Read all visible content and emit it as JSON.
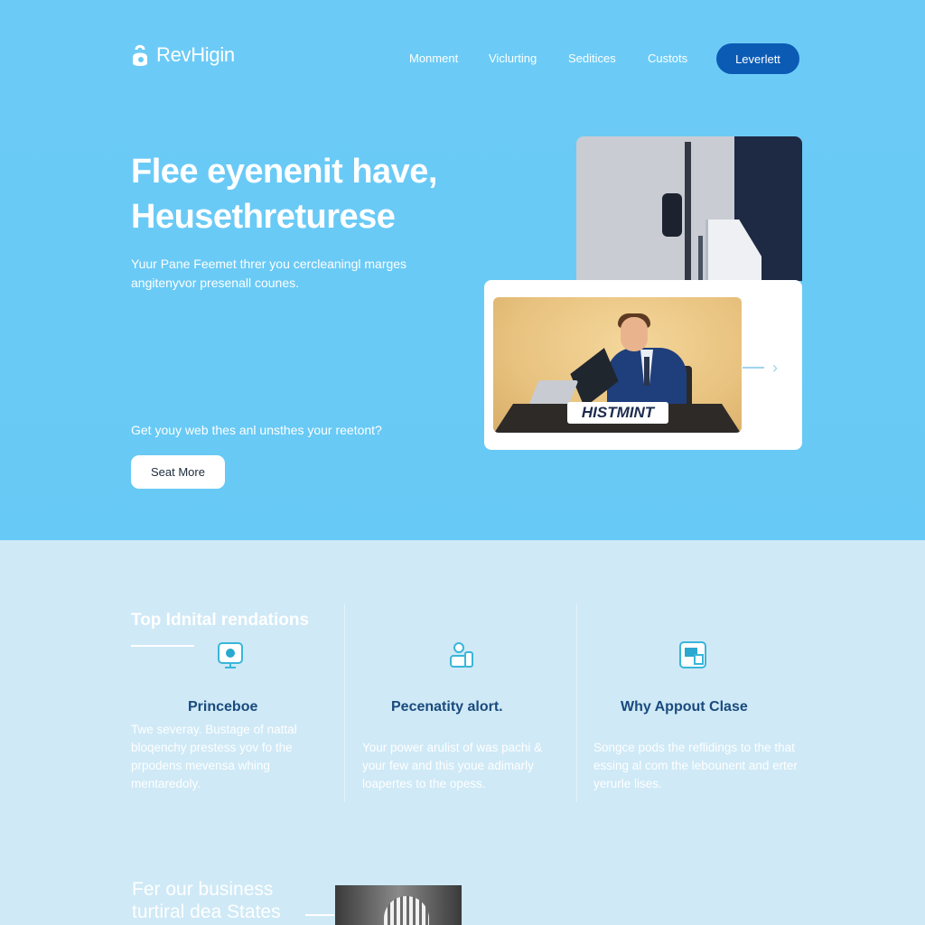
{
  "brand": {
    "name": "RevHigin"
  },
  "nav": {
    "links": [
      "Monment",
      "Viclurting",
      "Seditices",
      "Custots"
    ],
    "cta": "Leverlett"
  },
  "hero": {
    "title_line1": "Flee eyenenit have,",
    "title_line2": "Heusethreturese",
    "subtitle": "Yuur Pane Feemet threr you cercleaningl marges angitenyvor presenall counes.",
    "question": "Get youy web thes anl unsthes your reetont?",
    "button": "Seat More",
    "sign_text": "HISTMINT"
  },
  "features": {
    "title": "Top Idnital rendations",
    "items": [
      {
        "icon": "monitor-icon",
        "heading": "Princeboe",
        "body": "Twe severay. Bustage of nattal bloqenchy prestess yov fo the prpodens mevensa whing mentaredoly."
      },
      {
        "icon": "people-icon",
        "heading": "Pecenatity alort.",
        "body": "Your power arulist of was pachi & your few and this youe adimarly loapertes to the opess."
      },
      {
        "icon": "window-icon",
        "heading": "Why Appout Clase",
        "body": "Songce pods the reflidings to the that essing al com the lebounent and erter yerurle lises."
      }
    ]
  },
  "bottom": {
    "title_line1": "Fer our  business",
    "title_line2": "turtiral dea States"
  },
  "colors": {
    "hero_bg": "#6ccbf6",
    "cta": "#0b5bb5",
    "feature_heading": "#1a4a7e",
    "section_bg": "#cfe9f6"
  }
}
